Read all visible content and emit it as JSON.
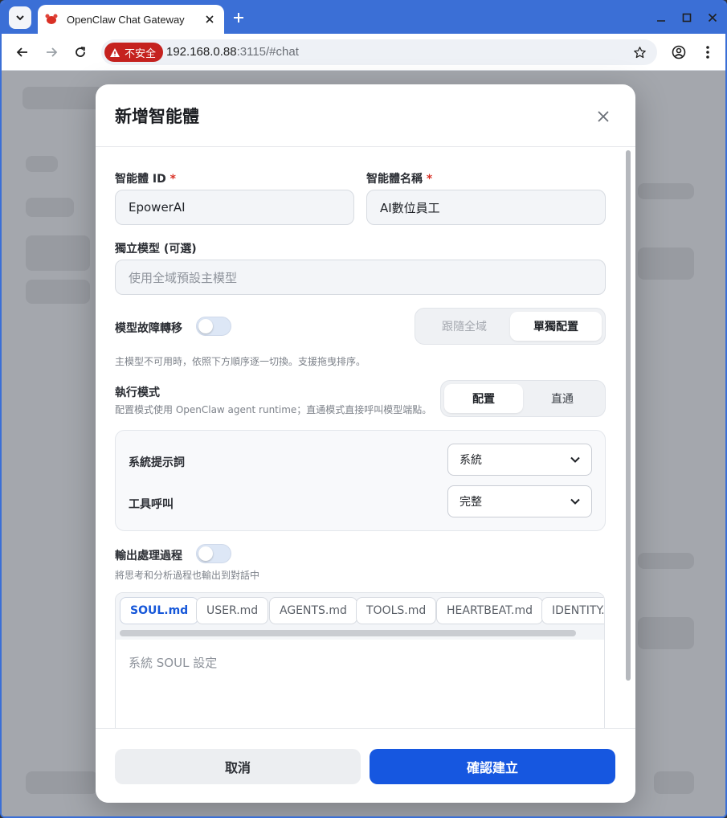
{
  "browser": {
    "tab_title": "OpenClaw Chat Gateway",
    "insecure_label": "不安全",
    "url_host": "192.168.0.88",
    "url_rest": ":3115/#chat"
  },
  "modal": {
    "title": "新增智能體",
    "agent_id_label": "智能體 ID",
    "agent_id_value": "EpowerAI",
    "agent_name_label": "智能體名稱",
    "agent_name_value": "AI數位員工",
    "required_mark": "*",
    "model_label": "獨立模型 (可選)",
    "model_placeholder": "使用全域預設主模型",
    "failover_label": "模型故障轉移",
    "failover_hint": "主模型不可用時，依照下方順序逐一切換。支援拖曳排序。",
    "failover_mode": {
      "options": [
        "跟隨全域",
        "單獨配置"
      ],
      "selected": "單獨配置"
    },
    "exec_label": "執行模式",
    "exec_hint": "配置模式使用 OpenClaw agent runtime；直通模式直接呼叫模型端點。",
    "exec_mode": {
      "options": [
        "配置",
        "直通"
      ],
      "selected": "配置"
    },
    "system_prompt_label": "系統提示詞",
    "system_prompt_value": "系統",
    "tool_call_label": "工具呼叫",
    "tool_call_value": "完整",
    "output_process_label": "輸出處理過程",
    "output_process_hint": "將思考和分析過程也輸出到對話中",
    "file_tabs": [
      "SOUL.md",
      "USER.md",
      "AGENTS.md",
      "TOOLS.md",
      "HEARTBEAT.md",
      "IDENTITY.md"
    ],
    "active_file_tab": "SOUL.md",
    "editor_placeholder": "系統 SOUL 設定",
    "cancel_label": "取消",
    "confirm_label": "確認建立"
  },
  "colors": {
    "accent": "#1657e0",
    "chrome": "#3b6fd6",
    "insecure": "#c5221f"
  }
}
